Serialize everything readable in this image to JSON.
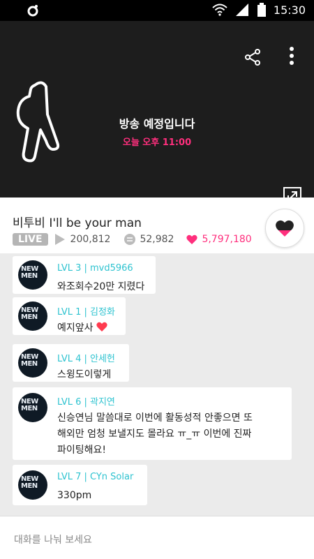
{
  "status_bar": {
    "time": "15:30"
  },
  "player": {
    "schedule_title": "방송 예정입니다",
    "schedule_time": "오늘 오후 11:00"
  },
  "video": {
    "title": "비투비 I'll be your man",
    "live_label": "LIVE",
    "views": "200,812",
    "comments": "52,982",
    "likes": "5,797,180"
  },
  "chat": {
    "messages": [
      {
        "avatar_text": "NEW MEN",
        "name": "LVL 3 | mvd5966",
        "text": "와조회수20만 지렸다"
      },
      {
        "avatar_text": "NEW MEN",
        "name": "LVL 1 | 김정화",
        "text": "예지앞사"
      },
      {
        "avatar_text": "NEW MEN",
        "name": "LVL 4 | 안세헌",
        "text": "스윙도이렇게"
      },
      {
        "avatar_text": "NEW MEN",
        "name": "LVL 6 | 곽지연",
        "text_lines": [
          "신승연님 말씀대로 이번에 활동성적 안좋으면 또",
          "해외만 엄청 보낼지도 몰라요 ㅠ_ㅠ 이번에 진짜",
          "파이팅해요!"
        ]
      },
      {
        "avatar_text": "NEW MEN",
        "name": "LVL 7 | CYn Solar",
        "text": "330pm"
      }
    ]
  },
  "input": {
    "placeholder": "대화를 나눠 보세요"
  },
  "colors": {
    "accent_pink": "#ff2f7d",
    "name_cyan": "#2ec3d0",
    "player_bg": "#1d1d1d"
  }
}
